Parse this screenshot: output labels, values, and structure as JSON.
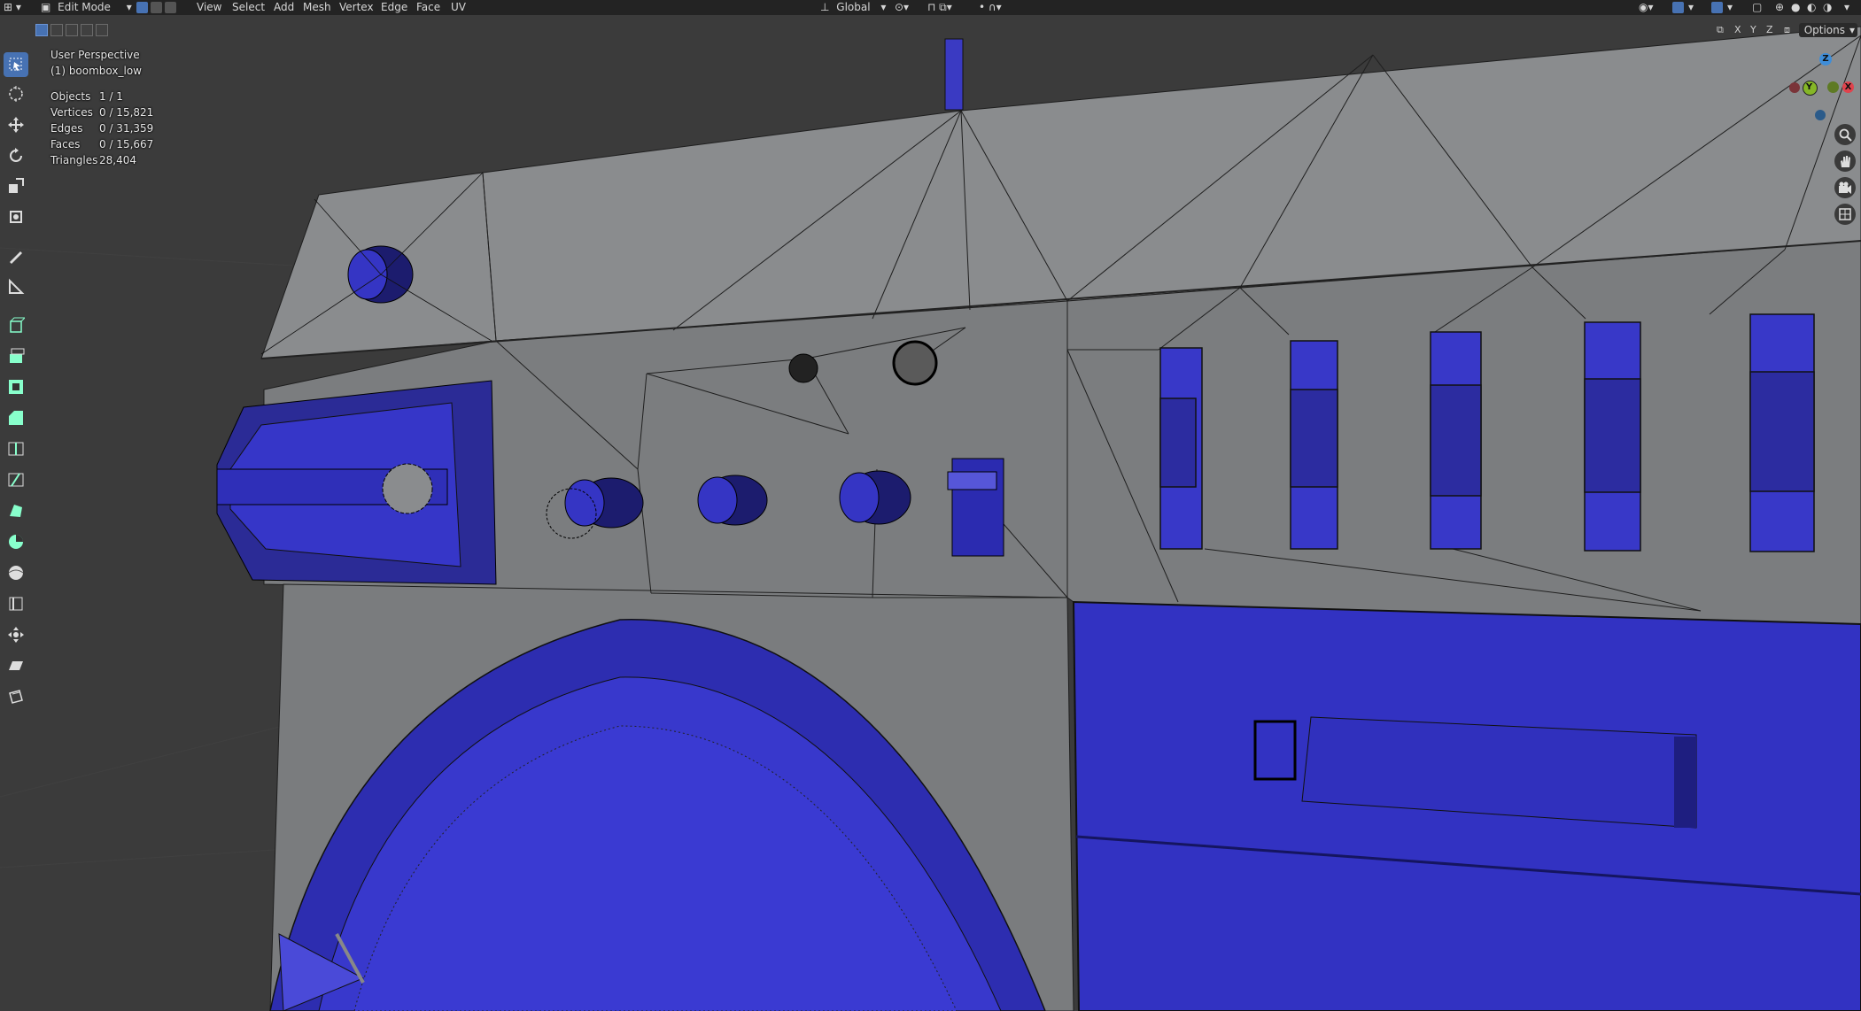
{
  "header": {
    "mode": "Edit Mode",
    "menus": [
      "View",
      "Select",
      "Add",
      "Mesh",
      "Vertex",
      "Edge",
      "Face",
      "UV"
    ],
    "transform_orientation": "Global",
    "options_label": "Options",
    "axis_toggles": [
      "X",
      "Y",
      "Z"
    ]
  },
  "overlay": {
    "view_name": "User Perspective",
    "object_name": "(1) boombox_low",
    "stats": [
      {
        "label": "Objects",
        "value": "1 / 1"
      },
      {
        "label": "Vertices",
        "value": "0 / 15,821"
      },
      {
        "label": "Edges",
        "value": "0 / 31,359"
      },
      {
        "label": "Faces",
        "value": "0 / 15,667"
      },
      {
        "label": "Triangles",
        "value": "28,404"
      }
    ]
  },
  "toolbar": {
    "tools": [
      {
        "name": "select-box",
        "icon": "select-box-icon",
        "active": true
      },
      {
        "name": "cursor",
        "icon": "cursor-icon"
      },
      {
        "name": "move",
        "icon": "move-icon"
      },
      {
        "name": "rotate",
        "icon": "rotate-icon"
      },
      {
        "name": "scale",
        "icon": "scale-icon"
      },
      {
        "name": "transform",
        "icon": "transform-icon"
      },
      {
        "name": "annotate",
        "icon": "annotate-icon"
      },
      {
        "name": "measure",
        "icon": "measure-icon"
      },
      {
        "name": "add-cube",
        "icon": "add-cube-icon"
      },
      {
        "name": "extrude-region",
        "icon": "extrude-icon"
      },
      {
        "name": "inset-faces",
        "icon": "inset-icon"
      },
      {
        "name": "bevel",
        "icon": "bevel-icon"
      },
      {
        "name": "loop-cut",
        "icon": "loop-cut-icon"
      },
      {
        "name": "knife",
        "icon": "knife-icon"
      },
      {
        "name": "poly-build",
        "icon": "poly-build-icon"
      },
      {
        "name": "spin",
        "icon": "spin-icon"
      },
      {
        "name": "smooth",
        "icon": "smooth-icon"
      },
      {
        "name": "edge-slide",
        "icon": "edge-slide-icon"
      },
      {
        "name": "shrink-fatten",
        "icon": "shrink-fatten-icon"
      },
      {
        "name": "shear",
        "icon": "shear-icon"
      },
      {
        "name": "rip-region",
        "icon": "rip-icon"
      }
    ]
  },
  "gizmo": {
    "labels": {
      "x": "X",
      "y": "Y",
      "z": "Z"
    },
    "colors": {
      "x": "#e0434d",
      "y": "#85b627",
      "z": "#3e8dd8"
    }
  },
  "nav_buttons": [
    "zoom-icon",
    "hand-pan-icon",
    "camera-icon",
    "grid-ortho-icon"
  ],
  "colors": {
    "viewport_bg": "#3b3b3b",
    "mesh_gray": "#7d7f80",
    "face_selected": "#3535c4",
    "header_bg": "#232323",
    "accent": "#4772b3"
  }
}
